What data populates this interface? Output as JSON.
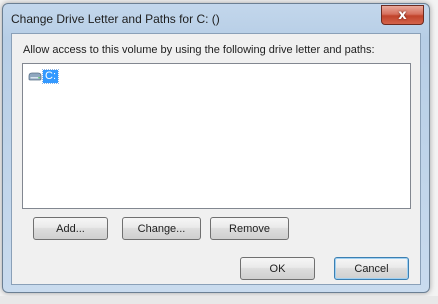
{
  "window": {
    "title": "Change Drive Letter and Paths for C: ()",
    "close_glyph": "x"
  },
  "dialog": {
    "prompt": "Allow access to this volume by using the following drive letter and paths:",
    "paths": [
      {
        "icon": "drive-icon",
        "label": "C:",
        "selected": true
      }
    ]
  },
  "buttons": {
    "add": "Add...",
    "change": "Change...",
    "remove": "Remove",
    "ok": "OK",
    "cancel": "Cancel"
  },
  "colors": {
    "selection": "#3399ff",
    "close_button": "#c1432b",
    "frame": "#b7cee6"
  }
}
